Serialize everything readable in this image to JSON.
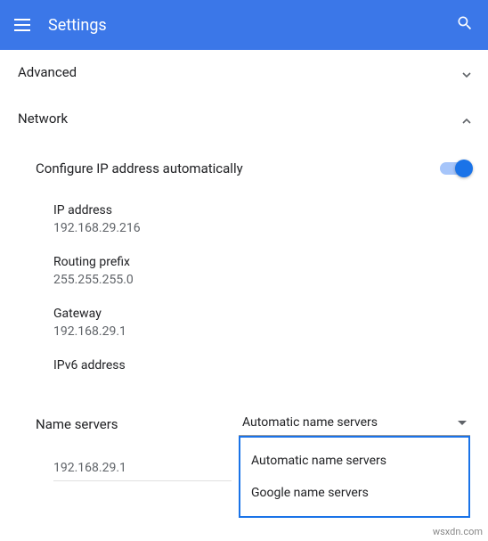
{
  "header": {
    "title": "Settings"
  },
  "sections": {
    "advanced": {
      "label": "Advanced"
    },
    "network": {
      "label": "Network"
    }
  },
  "network": {
    "auto_ip_label": "Configure IP address automatically",
    "auto_ip_enabled": true,
    "fields": {
      "ip_label": "IP address",
      "ip_value": "192.168.29.216",
      "routing_label": "Routing prefix",
      "routing_value": "255.255.255.0",
      "gateway_label": "Gateway",
      "gateway_value": "192.168.29.1",
      "ipv6_label": "IPv6 address",
      "ipv6_value": ""
    },
    "name_servers_label": "Name servers",
    "name_servers_selected": "Automatic name servers",
    "name_servers_options": {
      "0": "Automatic name servers",
      "1": "Google name servers"
    },
    "name_servers_value": "192.168.29.1"
  },
  "watermark": "wsxdn.com"
}
